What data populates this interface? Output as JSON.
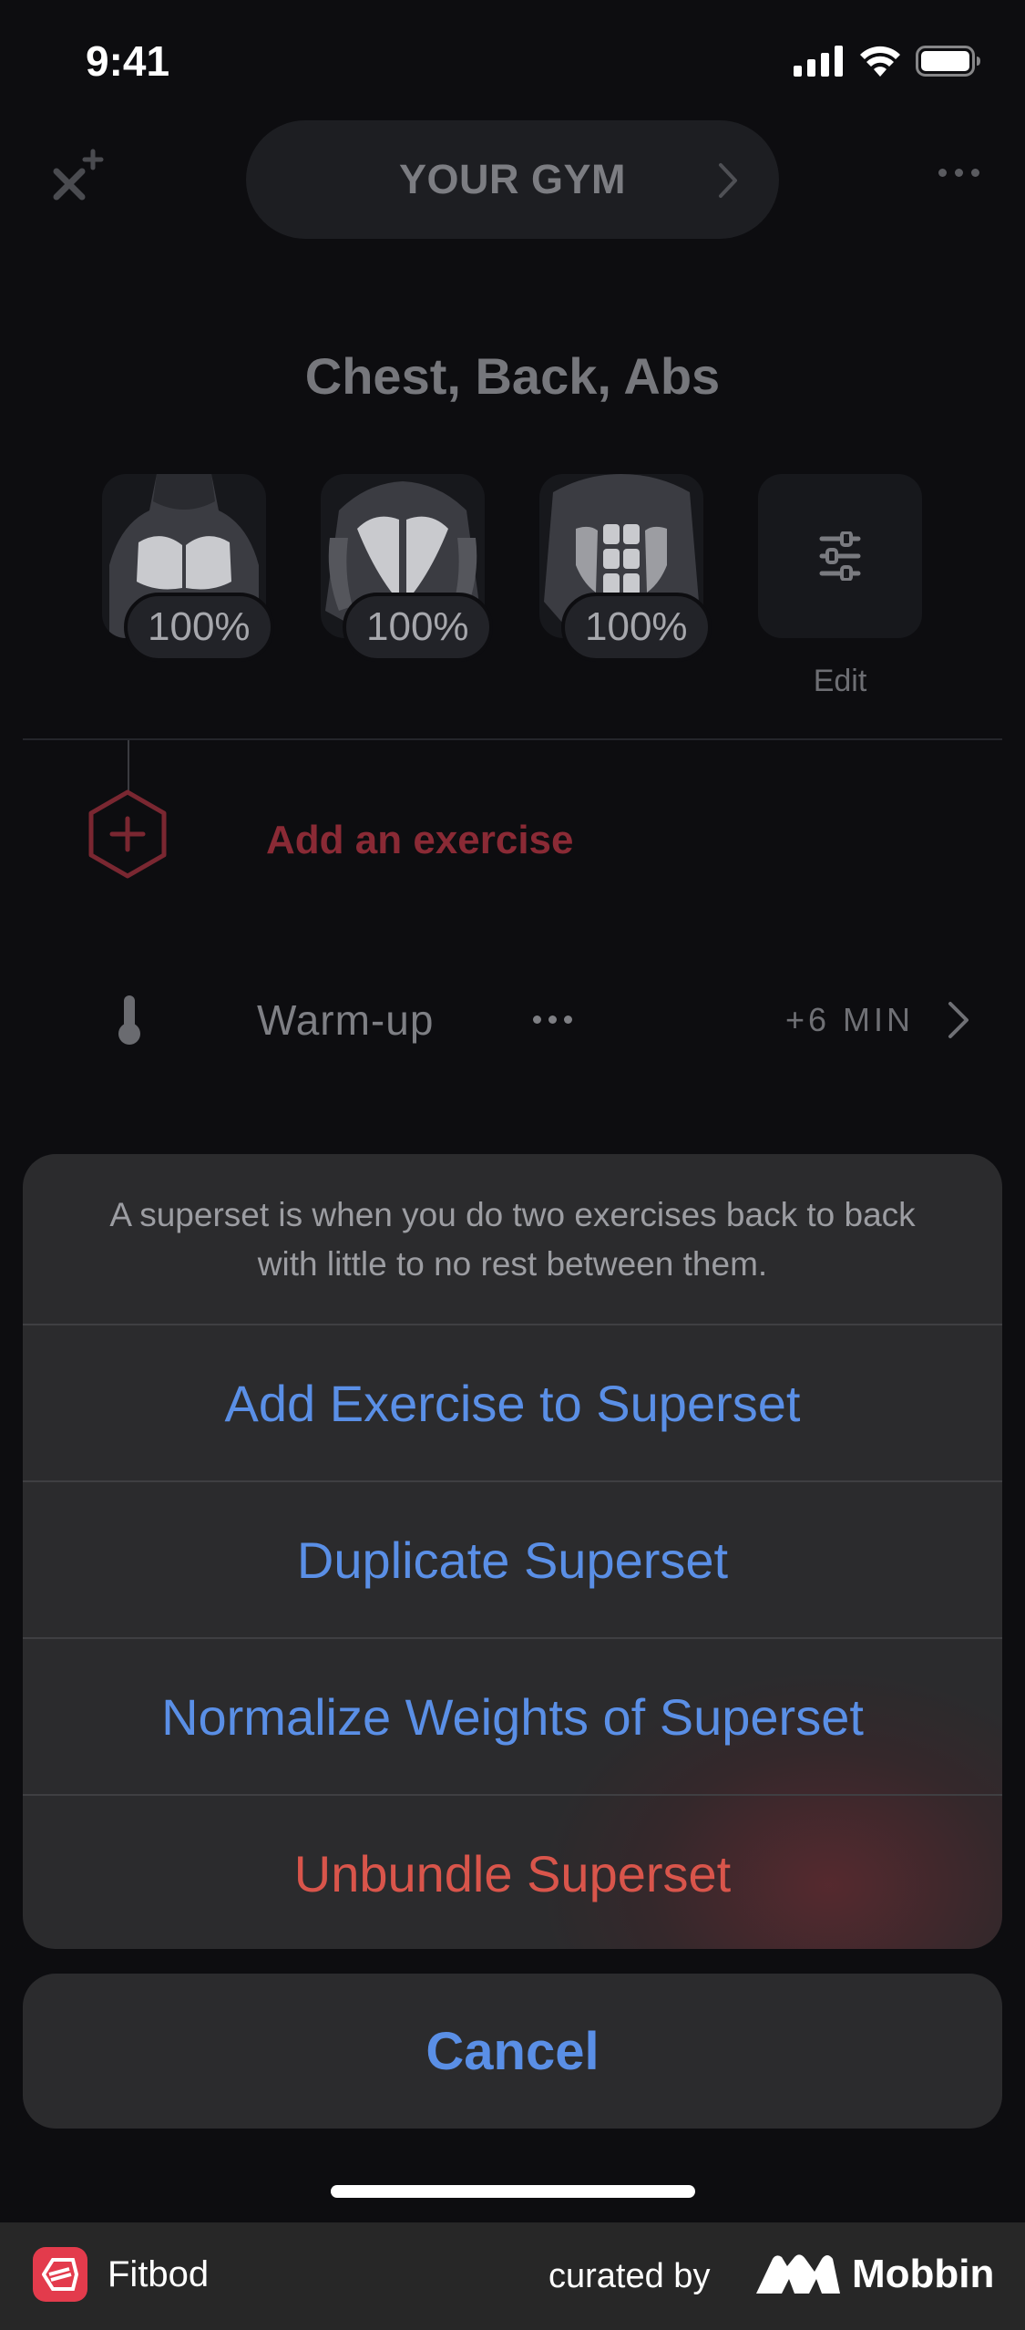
{
  "status_bar": {
    "time": "9:41"
  },
  "nav": {
    "gym_label": "YOUR GYM"
  },
  "workout": {
    "title": "Chest, Back, Abs",
    "muscle_groups": [
      {
        "icon": "chest-icon",
        "percent": "100%"
      },
      {
        "icon": "back-icon",
        "percent": "100%"
      },
      {
        "icon": "abs-icon",
        "percent": "100%"
      }
    ],
    "edit_label": "Edit",
    "add_exercise_label": "Add an exercise",
    "warmup": {
      "label": "Warm-up",
      "duration": "+6 MIN"
    }
  },
  "action_sheet": {
    "message": "A superset is when you do two exercises back to back with little to no rest between them.",
    "actions": [
      {
        "label": "Add Exercise to Superset",
        "style": "default"
      },
      {
        "label": "Duplicate Superset",
        "style": "default"
      },
      {
        "label": "Normalize Weights of Superset",
        "style": "default"
      },
      {
        "label": "Unbundle Superset",
        "style": "destructive"
      }
    ],
    "cancel_label": "Cancel"
  },
  "footer": {
    "app_name": "Fitbod",
    "curated_by": "curated by",
    "brand": "Mobbin"
  },
  "colors": {
    "action_blue": "#5a8fe6",
    "destructive_red": "#d9554b",
    "accent_red": "#8a2a35"
  }
}
